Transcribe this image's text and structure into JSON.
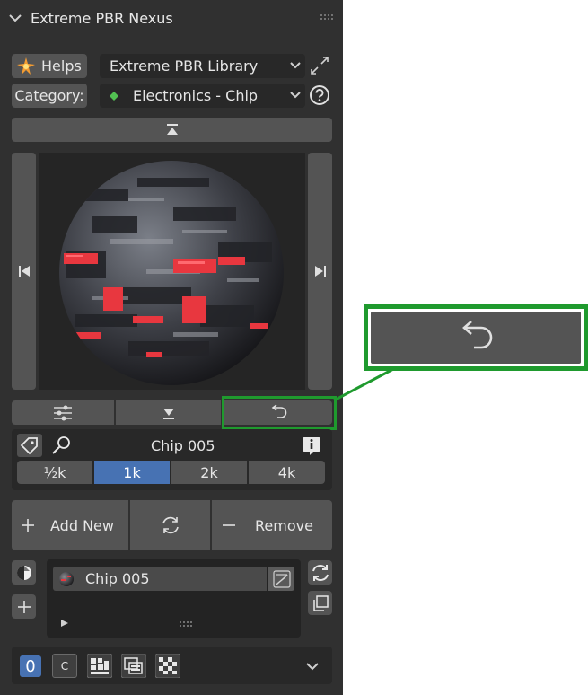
{
  "panel": {
    "title": "Extreme PBR Nexus",
    "helps_label": "Helps",
    "library_value": "Extreme PBR Library",
    "category_label": "Category:",
    "category_value": "Electronics - Chip",
    "material_name": "Chip 005",
    "resolutions": [
      "½k",
      "1k",
      "2k",
      "4k"
    ],
    "selected_resolution": "1k",
    "add_new_label": "Add New",
    "remove_label": "Remove",
    "slot_name": "Chip 005",
    "bottom_slot_number": "0",
    "bottom_c_label": "C"
  },
  "colors": {
    "accent_blue": "#4772b3",
    "highlight_green": "#1f9a2e",
    "category_diamond": "#52c152"
  },
  "icons": {
    "collapse": "chevron-down-icon",
    "drag": "drag-dots-icon",
    "helps": "sparkle-icon",
    "expand": "expand-arrows-icon",
    "help": "question-icon",
    "top": "arrow-top-icon",
    "prev": "skip-prev-icon",
    "next": "skip-next-icon",
    "sliders": "sliders-icon",
    "bottom": "arrow-bottom-icon",
    "undo": "undo-icon",
    "tag": "tag-icon",
    "search": "search-icon",
    "info": "info-icon",
    "add": "plus-icon",
    "refresh": "refresh-icon",
    "remove": "minus-icon"
  }
}
